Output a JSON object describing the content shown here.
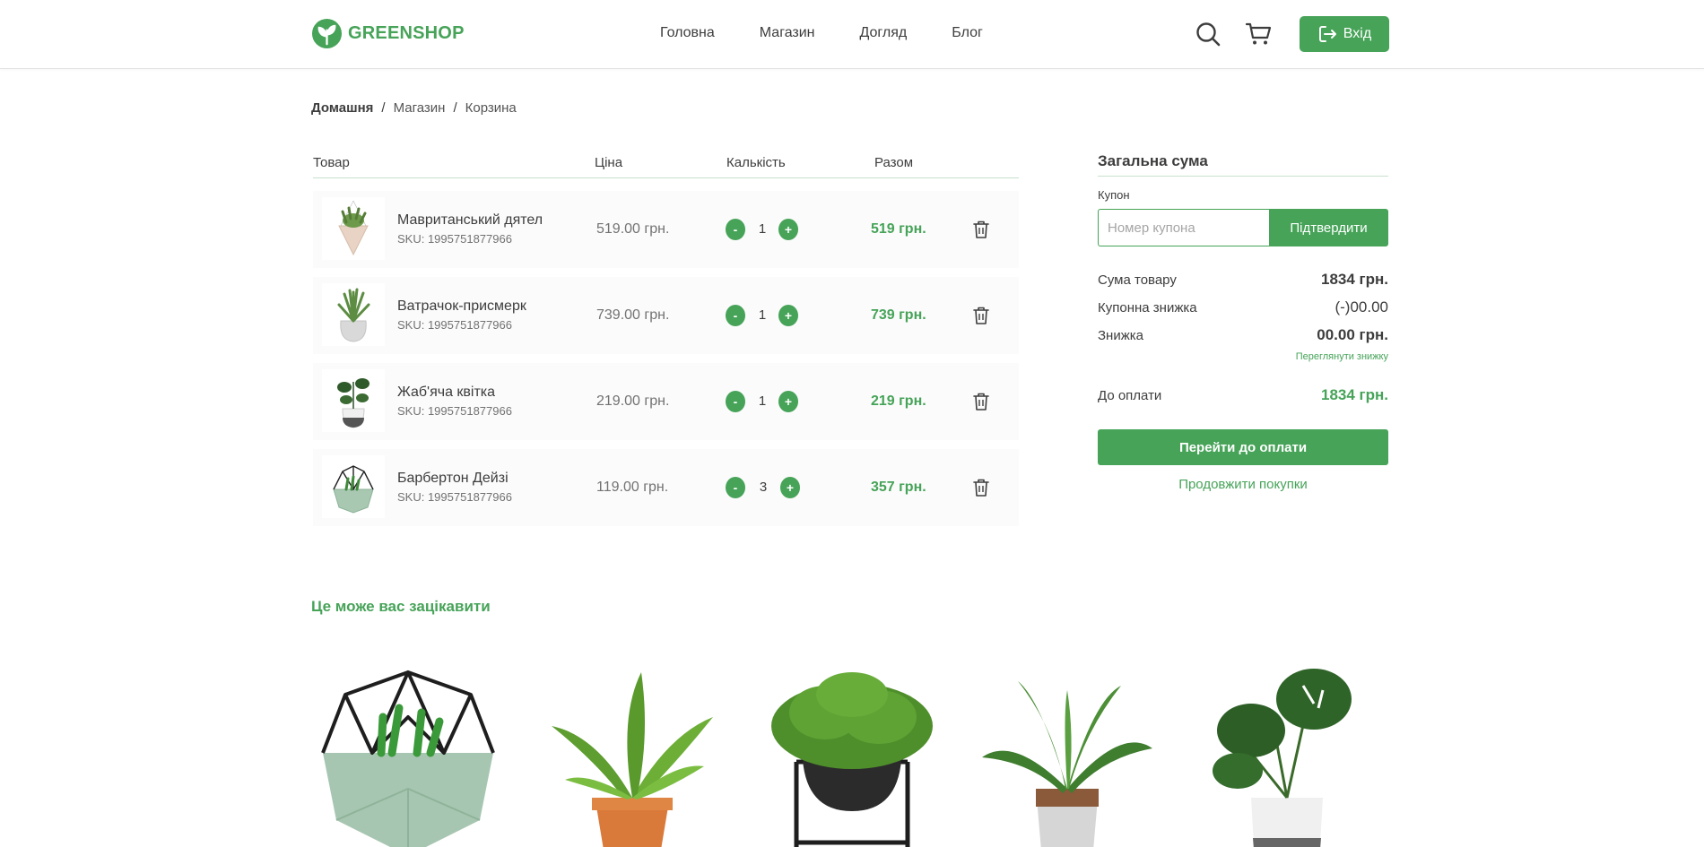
{
  "header": {
    "logo_text": "GREENSHOP",
    "nav": [
      "Головна",
      "Магазин",
      "Догляд",
      "Блог"
    ],
    "login_label": "Вхід"
  },
  "breadcrumb": [
    "Домашня",
    "Магазин",
    "Корзина"
  ],
  "cart": {
    "columns": [
      "Товар",
      "Ціна",
      "Калькість",
      "Разом"
    ],
    "items": [
      {
        "name": "Мавританський дятел",
        "sku": "SKU: 1995751877966",
        "price": "519.00 грн.",
        "qty": "1",
        "total": "519 грн."
      },
      {
        "name": "Ватрачок-присмерк",
        "sku": "SKU: 1995751877966",
        "price": "739.00 грн.",
        "qty": "1",
        "total": "739 грн."
      },
      {
        "name": "Жаб'яча квітка",
        "sku": "SKU: 1995751877966",
        "price": "219.00 грн.",
        "qty": "1",
        "total": "219 грн."
      },
      {
        "name": "Барбертон Дейзі",
        "sku": "SKU: 1995751877966",
        "price": "119.00 грн.",
        "qty": "3",
        "total": "357 грн."
      }
    ],
    "minus_label": "-",
    "plus_label": "+"
  },
  "summary": {
    "title": "Загальна сума",
    "coupon_label": "Купон",
    "coupon_placeholder": "Номер купона",
    "coupon_button": "Підтвердити",
    "subtotal_label": "Сума товару",
    "subtotal_value": "1834 грн.",
    "coupon_discount_label": "Купонна знижка",
    "coupon_discount_value": "(-)00.00",
    "discount_label": "Знижка",
    "discount_value": "00.00 грн.",
    "view_discount_link": "Переглянути знижку",
    "total_label": "До оплати",
    "total_value": "1834 грн.",
    "checkout_button": "Перейти до оплати",
    "continue_link": "Продовжити покупки"
  },
  "related": {
    "title": "Це може вас зацікавити"
  },
  "colors": {
    "accent": "#46a358",
    "text": "#3d3d3d",
    "muted": "#727272"
  }
}
